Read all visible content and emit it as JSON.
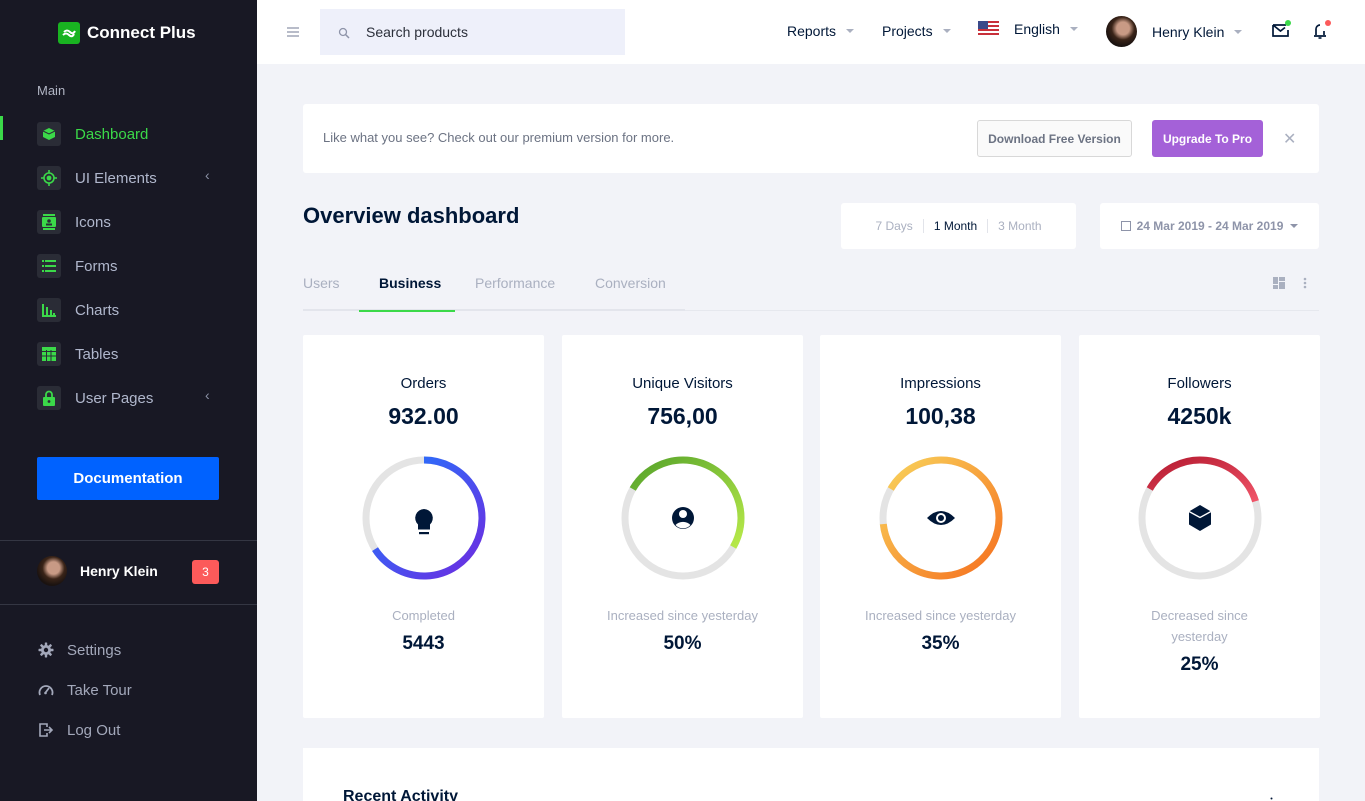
{
  "brand": {
    "name": "Connect Plus",
    "logo_icon": "logo-icon"
  },
  "sidebar": {
    "category": "Main",
    "items": [
      {
        "label": "Dashboard",
        "icon": "cube-icon",
        "active": true,
        "has_arrow": false
      },
      {
        "label": "UI Elements",
        "icon": "crosshairs-icon",
        "active": false,
        "has_arrow": true
      },
      {
        "label": "Icons",
        "icon": "contacts-icon",
        "active": false,
        "has_arrow": false
      },
      {
        "label": "Forms",
        "icon": "list-icon",
        "active": false,
        "has_arrow": false
      },
      {
        "label": "Charts",
        "icon": "bar-chart-icon",
        "active": false,
        "has_arrow": false
      },
      {
        "label": "Tables",
        "icon": "table-icon",
        "active": false,
        "has_arrow": false
      },
      {
        "label": "User Pages",
        "icon": "lock-icon",
        "active": false,
        "has_arrow": true
      }
    ],
    "arrow_glyph": "‹",
    "documentation_button": "Documentation",
    "profile": {
      "name": "Henry Klein",
      "badge": "3"
    },
    "bottom_links": [
      {
        "label": "Settings",
        "icon": "gear-icon"
      },
      {
        "label": "Take Tour",
        "icon": "speedometer-icon"
      },
      {
        "label": "Log Out",
        "icon": "logout-icon"
      }
    ]
  },
  "header": {
    "search": {
      "placeholder": "Search products",
      "value": ""
    },
    "menus": {
      "reports": "Reports",
      "projects": "Projects",
      "language": "English",
      "user": "Henry Klein"
    },
    "mail_dot_color": "#3bd949",
    "bell_dot_color": "#fc5a5a"
  },
  "banner": {
    "text": "Like what you see? Check out our premium version for more.",
    "download_button": "Download Free Version",
    "upgrade_button": "Upgrade To Pro",
    "close_glyph": "✕"
  },
  "main": {
    "title": "Overview dashboard",
    "ranges": [
      {
        "label": "7 Days",
        "active": false
      },
      {
        "label": "1 Month",
        "active": true
      },
      {
        "label": "3 Month",
        "active": false
      }
    ],
    "date_range": "24 Mar 2019 - 24 Mar 2019",
    "tabs": [
      {
        "label": "Users",
        "active": false
      },
      {
        "label": "Business",
        "active": true
      },
      {
        "label": "Performance",
        "active": false
      },
      {
        "label": "Conversion",
        "active": false
      }
    ],
    "cards": [
      {
        "title": "Orders",
        "value": "932.00",
        "subtitle": "Completed",
        "stat": "5443",
        "icon": "lightbulb-icon",
        "progress": 0.66,
        "start_angle_deg": 0,
        "colors": [
          "#1e7bff",
          "#6f2ae0"
        ]
      },
      {
        "title": "Unique Visitors",
        "value": "756,00",
        "subtitle": "Increased since yesterday",
        "stat": "50%",
        "icon": "account-circle-icon",
        "progress": 0.5,
        "start_angle_deg": -60,
        "colors": [
          "#56a32a",
          "#b8ea4a"
        ]
      },
      {
        "title": "Impressions",
        "value": "100,38",
        "subtitle": "Increased since yesterday",
        "stat": "35%",
        "icon": "eye-icon",
        "progress": 0.9,
        "start_angle_deg": -60,
        "colors": [
          "#f9d45c",
          "#f56f1e"
        ]
      },
      {
        "title": "Followers",
        "value": "4250k",
        "subtitle": "Decreased since yesterday",
        "stat": "25%",
        "icon": "cube-icon",
        "progress": 0.37,
        "start_angle_deg": -60,
        "colors": [
          "#b51a30",
          "#f05468"
        ]
      }
    ],
    "recent_activity_title": "Recent Activity"
  }
}
